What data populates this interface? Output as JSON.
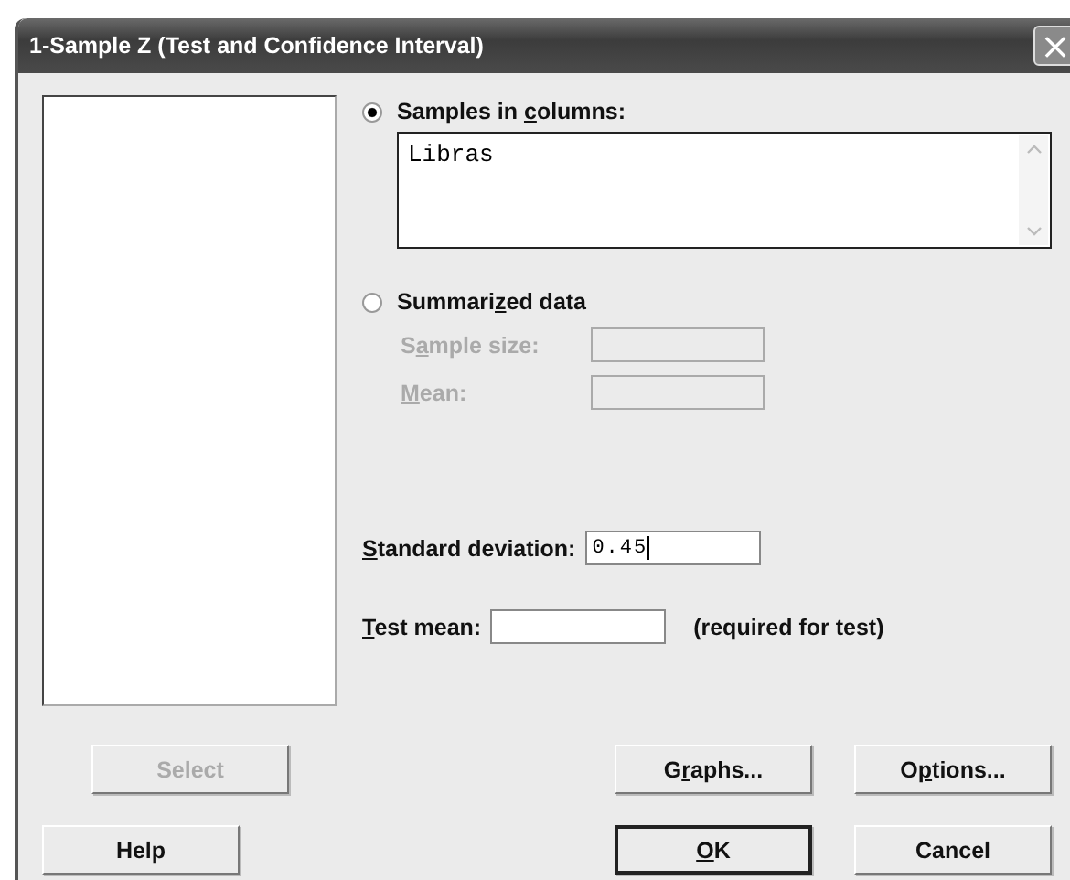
{
  "window": {
    "title": "1-Sample Z (Test and Confidence Interval)",
    "close": "×"
  },
  "samples": {
    "label": [
      {
        "text": "Samples in ",
        "underline": false
      },
      {
        "text": "c",
        "underline": true
      },
      {
        "text": "olumns:",
        "underline": false
      }
    ],
    "selected": true,
    "value": "Libras"
  },
  "summarized": {
    "label": [
      {
        "text": "Summari",
        "underline": false
      },
      {
        "text": "z",
        "underline": true
      },
      {
        "text": "ed data",
        "underline": false
      }
    ],
    "selected": false,
    "fields": [
      {
        "label": [
          {
            "text": "S",
            "underline": false
          },
          {
            "text": "a",
            "underline": true
          },
          {
            "text": "mple size:",
            "underline": false
          }
        ],
        "disabled": true
      },
      {
        "label": [
          {
            "text": "M",
            "underline": true
          },
          {
            "text": "ean:",
            "underline": false
          }
        ],
        "disabled": true
      }
    ]
  },
  "std_dev": {
    "label": [
      {
        "text": "S",
        "underline": true
      },
      {
        "text": "tandard deviation:",
        "underline": false
      }
    ],
    "value": "0.45",
    "focused": true
  },
  "test_mean": {
    "label": [
      {
        "text": "T",
        "underline": true
      },
      {
        "text": "est mean:",
        "underline": false
      }
    ],
    "note": "(required for test)"
  },
  "buttons": {
    "row1_left": [
      {
        "label": [
          {
            "text": "Select",
            "underline": false
          }
        ],
        "disabled": true,
        "default": false
      }
    ],
    "row1_right": [
      {
        "label": [
          {
            "text": "G",
            "underline": false
          },
          {
            "text": "r",
            "underline": true
          },
          {
            "text": "aphs...",
            "underline": false
          }
        ],
        "disabled": false,
        "default": false
      },
      {
        "label": [
          {
            "text": "O",
            "underline": false
          },
          {
            "text": "p",
            "underline": true
          },
          {
            "text": "tions...",
            "underline": false
          }
        ],
        "disabled": false,
        "default": false
      }
    ],
    "row2_left": [
      {
        "label": [
          {
            "text": "Help",
            "underline": false
          }
        ],
        "disabled": false,
        "default": false
      }
    ],
    "row2_right": [
      {
        "label": [
          {
            "text": "O",
            "underline": true
          },
          {
            "text": "K",
            "underline": false
          }
        ],
        "disabled": false,
        "default": true
      },
      {
        "label": [
          {
            "text": "Cancel",
            "underline": false
          }
        ],
        "disabled": false,
        "default": false
      }
    ]
  }
}
